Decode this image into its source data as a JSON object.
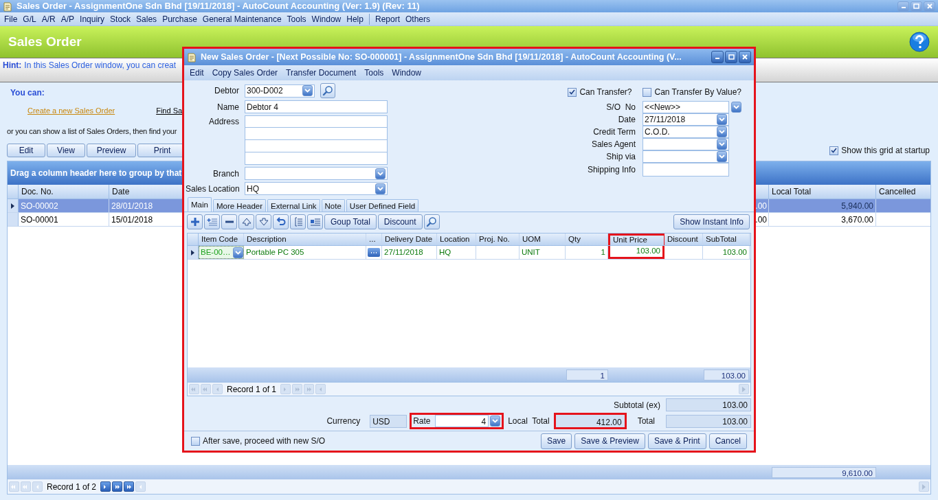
{
  "window": {
    "title": "Sales Order - AssignmentOne Sdn Bhd [19/11/2018] - AutoCount Accounting (Ver: 1.9) (Rev: 11)"
  },
  "menu": [
    "File",
    "G/L",
    "A/R",
    "A/P",
    "Inquiry",
    "Stock",
    "Sales",
    "Purchase",
    "General Maintenance",
    "Tools",
    "Window",
    "Help"
  ],
  "menu_extra": [
    "Report",
    "Others"
  ],
  "page_header": {
    "title": "Sales Order"
  },
  "hint": {
    "label": "Hint:",
    "text": "In this Sales Order window, you can creat"
  },
  "you_can": "You can:",
  "links": [
    {
      "label": "Create a new Sales Order",
      "color": "#c8860a"
    },
    {
      "label": "Find Sa",
      "color": "#000000"
    }
  ],
  "list_hint": "or you can show a list of Sales Orders, then find your",
  "actions": [
    "Edit",
    "View",
    "Preview",
    "Print"
  ],
  "show_grid": {
    "label": "Show this grid at startup",
    "checked": true
  },
  "grid": {
    "group_hint": "Drag a column header here to group by that",
    "columns": {
      "doc_no": "Doc. No.",
      "date": "Date",
      "local_total": "Local Total",
      "cancelled": "Cancelled"
    },
    "rows": [
      {
        "doc_no": "SO-00002",
        "date": "28/01/2018",
        "column_3": ".00",
        "local_total": "5,940.00",
        "selected": true
      },
      {
        "doc_no": "SO-00001",
        "date": "15/01/2018",
        "column_3": ".00",
        "local_total": "3,670.00",
        "selected": false
      }
    ],
    "total": "9,610.00",
    "record": "Record 1 of 2"
  },
  "dialog": {
    "title": "New Sales Order - [Next Possible No: SO-000001] - AssignmentOne Sdn Bhd [19/11/2018] - AutoCount Accounting (V...",
    "highlighted": true,
    "menu": [
      "Edit",
      "Copy Sales Order",
      "Transfer Document",
      "Tools",
      "Window"
    ],
    "left_fields": [
      {
        "label": "Debtor",
        "value": "300-D002",
        "kind": "lookup"
      },
      {
        "label": "Name",
        "value": "Debtor 4",
        "kind": "text"
      },
      {
        "label": "Address",
        "kind": "address"
      },
      {
        "label": "Branch",
        "kind": "dropdown"
      },
      {
        "label": "Sales Location",
        "value": "HQ",
        "kind": "dropdown"
      }
    ],
    "checks": [
      {
        "label": "Can Transfer?",
        "checked": true
      },
      {
        "label": "Can Transfer By Value?",
        "checked": false
      }
    ],
    "right_fields": [
      {
        "label": "S/O  No",
        "value": "<<New>>",
        "kind": "number"
      },
      {
        "label": "Date",
        "value": "27/11/2018",
        "kind": "dropdown"
      },
      {
        "label": "Credit Term",
        "value": "C.O.D.",
        "kind": "dropdown"
      },
      {
        "label": "Sales Agent",
        "kind": "dropdown"
      },
      {
        "label": "Ship via",
        "kind": "dropdown"
      },
      {
        "label": "Shipping Info",
        "kind": "text"
      }
    ],
    "tabs": [
      {
        "label": "Main",
        "selected": true
      },
      {
        "label": "More Header",
        "selected": false
      },
      {
        "label": "External Link",
        "selected": false
      },
      {
        "label": "Note",
        "selected": false
      },
      {
        "label": "User Defined Field",
        "selected": false
      }
    ],
    "toolbar": {
      "text_buttons": [
        "Goup Total",
        "Discount"
      ],
      "instant_info": "Show Instant Info"
    },
    "items": {
      "columns": [
        {
          "label": "Item Code",
          "highlighted": false
        },
        {
          "label": "Description",
          "highlighted": false
        },
        {
          "label": "...",
          "highlighted": false
        },
        {
          "label": "Delivery Date",
          "highlighted": false
        },
        {
          "label": "Location",
          "highlighted": false
        },
        {
          "label": "Proj. No.",
          "highlighted": false
        },
        {
          "label": "UOM",
          "highlighted": false
        },
        {
          "label": "Qty",
          "highlighted": false
        },
        {
          "label": "Unit Price",
          "highlighted": true
        },
        {
          "label": "Discount",
          "highlighted": false
        },
        {
          "label": "SubTotal",
          "highlighted": false
        }
      ],
      "rows": [
        {
          "item_code": "BE-00…",
          "description": "Portable PC 305",
          "delivery_date": "27/11/2018",
          "location": "HQ",
          "uom": "UNIT",
          "qty": "1",
          "unit_price": "103.00",
          "subtotal": "103.00"
        }
      ],
      "totals": {
        "qty": "1",
        "subtotal": "103.00"
      },
      "record": "Record 1 of 1"
    },
    "summary": {
      "subtotal_ex": {
        "label": "Subtotal (ex)",
        "value": "103.00"
      },
      "currency": {
        "label": "Currency",
        "value": "USD"
      },
      "rate": {
        "label": "Rate",
        "value": "4",
        "highlighted": true
      },
      "local_total": {
        "label": "Local  Total",
        "value": "412.00",
        "highlighted": true
      },
      "total": {
        "label": "Total",
        "value": "103.00"
      }
    },
    "after_save": {
      "label": "After save, proceed with new S/O",
      "checked": false
    },
    "buttons": [
      "Save",
      "Save & Preview",
      "Save & Print",
      "Cancel"
    ]
  }
}
